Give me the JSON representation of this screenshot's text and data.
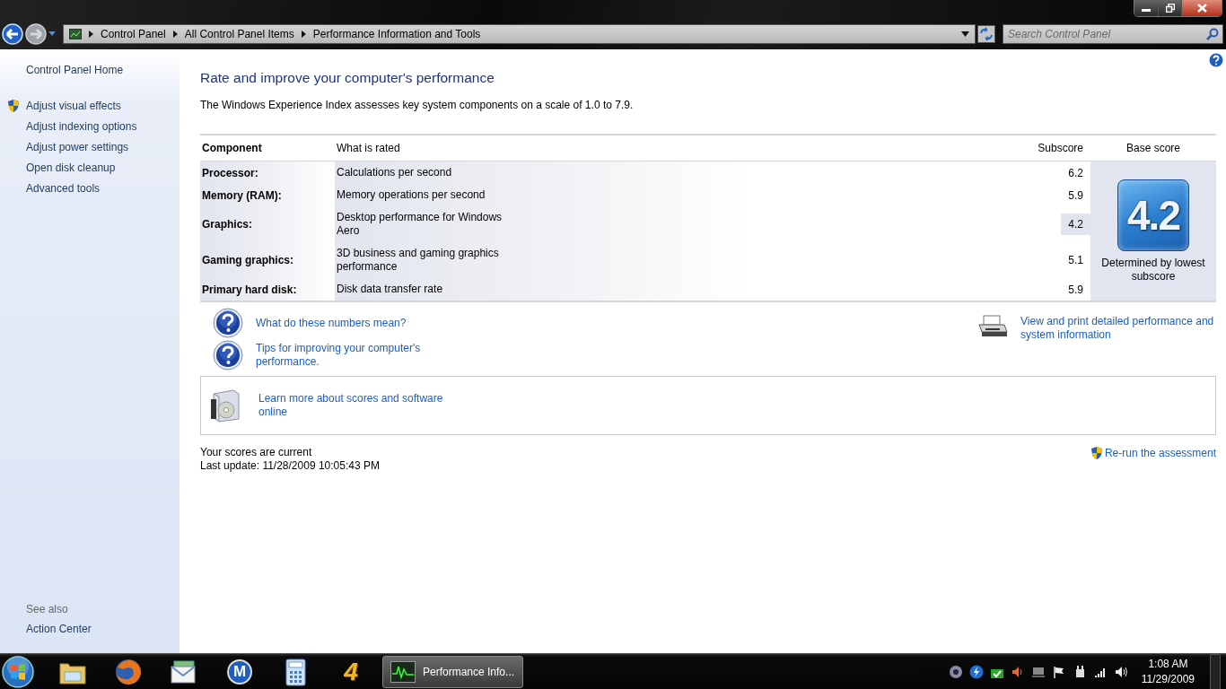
{
  "address_bar": {
    "breadcrumb": [
      "Control Panel",
      "All Control Panel Items",
      "Performance Information and Tools"
    ]
  },
  "search": {
    "placeholder": "Search Control Panel"
  },
  "sidebar": {
    "home": "Control Panel Home",
    "tasks": [
      {
        "label": "Adjust visual effects",
        "shield": true
      },
      {
        "label": "Adjust indexing options",
        "shield": false
      },
      {
        "label": "Adjust power settings",
        "shield": false
      },
      {
        "label": "Open disk cleanup",
        "shield": false
      },
      {
        "label": "Advanced tools",
        "shield": false
      }
    ],
    "see_also_title": "See also",
    "see_also": [
      "Action Center"
    ]
  },
  "heading": "Rate and improve your computer's performance",
  "description": "The Windows Experience Index assesses key system components on a scale of 1.0 to 7.9.",
  "table": {
    "columns": [
      "Component",
      "What is rated",
      "Subscore",
      "Base score"
    ],
    "rows": [
      {
        "component": "Processor:",
        "rated": "Calculations per second",
        "subscore": "6.2",
        "highlighted": false
      },
      {
        "component": "Memory (RAM):",
        "rated": "Memory operations per second",
        "subscore": "5.9",
        "highlighted": false
      },
      {
        "component": "Graphics:",
        "rated": "Desktop performance for Windows Aero",
        "subscore": "4.2",
        "highlighted": true
      },
      {
        "component": "Gaming graphics:",
        "rated": "3D business and gaming graphics performance",
        "subscore": "5.1",
        "highlighted": false
      },
      {
        "component": "Primary hard disk:",
        "rated": "Disk data transfer rate",
        "subscore": "5.9",
        "highlighted": false
      }
    ],
    "base_score": {
      "value": "4.2",
      "caption": "Determined by lowest subscore"
    }
  },
  "help_links": [
    "What do these numbers mean?",
    "Tips for improving your computer's performance."
  ],
  "print_link": "View and print detailed performance and system information",
  "learn_more": "Learn more about scores and software online",
  "status": [
    "Your scores are current",
    "Last update: 11/28/2009 10:05:43 PM"
  ],
  "rerun_link": "Re-run the assessment",
  "taskbar": {
    "pinned": [
      {
        "kind": "folder"
      },
      {
        "kind": "browser"
      },
      {
        "kind": "mail"
      },
      {
        "kind": "badge",
        "glyph": "M"
      },
      {
        "kind": "calculator"
      },
      {
        "kind": "glyph",
        "glyph": "4"
      }
    ],
    "windows": [
      {
        "label": "Performance Info...",
        "active": true
      }
    ],
    "clock": {
      "time": "1:08 AM",
      "date": "11/29/2009"
    }
  }
}
